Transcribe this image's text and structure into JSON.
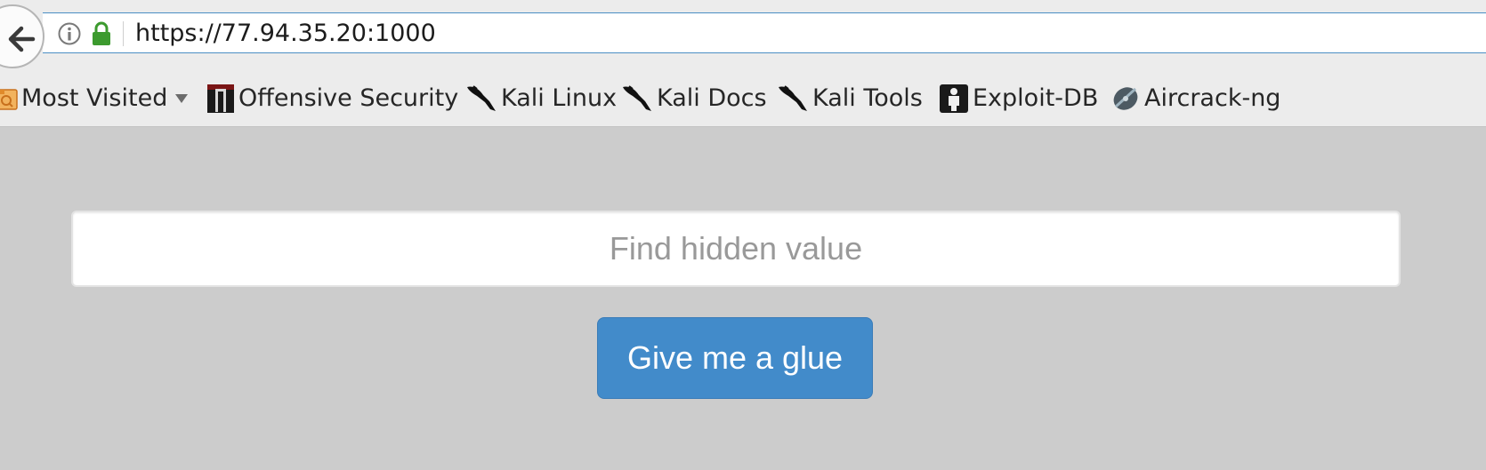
{
  "browser": {
    "url": "https://77.94.35.20:1000",
    "icons": {
      "back": "back-arrow-icon",
      "info": "info-icon",
      "lock": "lock-icon"
    },
    "lock_color": "#3c9a2e",
    "bookmarks": [
      {
        "label": "Most Visited",
        "icon": "folder-icon",
        "has_dropdown": true
      },
      {
        "label": "Offensive Security",
        "icon": "offensive-security-icon"
      },
      {
        "label": "Kali Linux",
        "icon": "kali-dragon-icon"
      },
      {
        "label": "Kali Docs",
        "icon": "kali-dragon-icon"
      },
      {
        "label": "Kali Tools",
        "icon": "kali-dragon-icon"
      },
      {
        "label": "Exploit-DB",
        "icon": "exploit-db-icon"
      },
      {
        "label": "Aircrack-ng",
        "icon": "aircrack-icon"
      }
    ]
  },
  "page": {
    "background": "#cccccc",
    "search": {
      "placeholder": "Find hidden value",
      "value": ""
    },
    "button": {
      "label": "Give me a glue",
      "color": "#428bca"
    }
  }
}
